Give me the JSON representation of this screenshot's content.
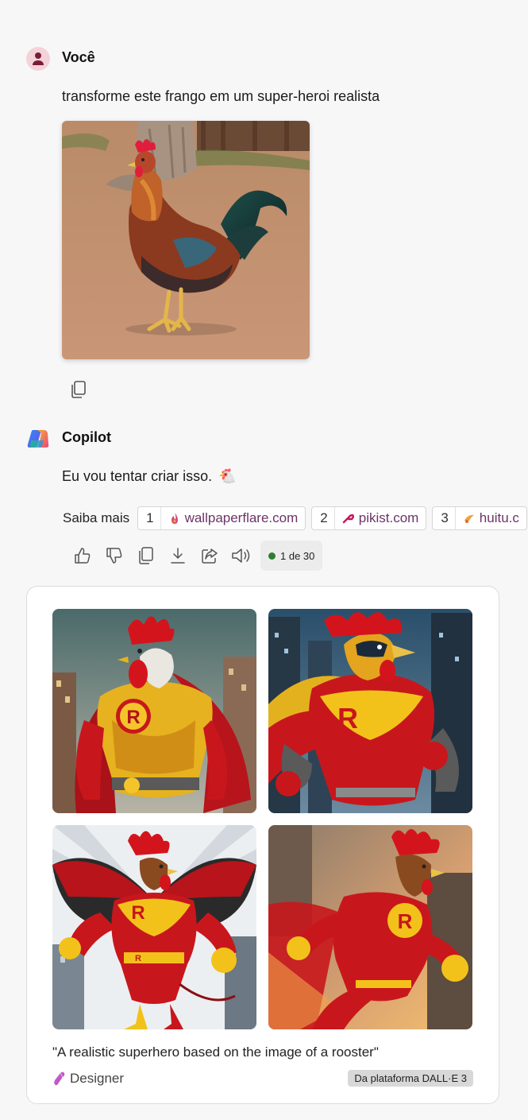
{
  "user_message": {
    "sender": "Você",
    "text": "transforme este frango em um super-heroi realista",
    "image_alt": "rooster photo",
    "copy_icon": "copy-icon"
  },
  "copilot_message": {
    "sender": "Copilot",
    "text": "Eu vou tentar criar isso.",
    "emoji": "🐔",
    "learn_more_label": "Saiba mais",
    "citations": [
      {
        "num": "1",
        "domain": "wallpaperflare.com",
        "icon": "flame-icon"
      },
      {
        "num": "2",
        "domain": "pikist.com",
        "icon": "pikist-icon"
      },
      {
        "num": "3",
        "domain": "huitu.c",
        "icon": "huitu-icon"
      }
    ],
    "actions": [
      "thumbs-up-icon",
      "thumbs-down-icon",
      "copy-icon",
      "download-icon",
      "share-icon",
      "speaker-icon"
    ],
    "counter": "1 de 30"
  },
  "image_card": {
    "caption": "\"A realistic superhero based on the image of a rooster\"",
    "designer_label": "Designer",
    "badge": "Da plataforma DALL·E 3",
    "images": [
      "superhero rooster 1",
      "superhero rooster 2",
      "superhero rooster 3",
      "superhero rooster 4"
    ]
  },
  "colors": {
    "background": "#f7f7f8",
    "citation_link": "#6b3468",
    "counter_dot": "#2e7d32",
    "hero_red": "#c8171c",
    "hero_yellow": "#f2c21b"
  }
}
